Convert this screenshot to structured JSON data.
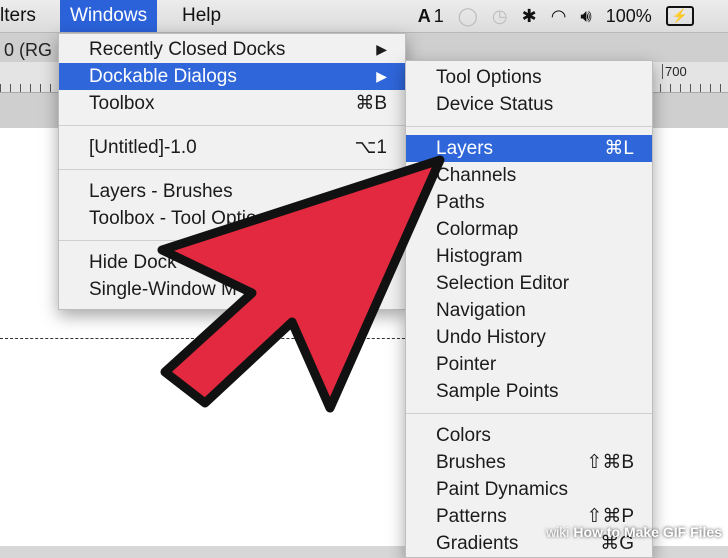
{
  "menubar": {
    "items": [
      "lters",
      "Windows",
      "Help"
    ],
    "status": {
      "adobe_count": "1",
      "battery": "100%"
    }
  },
  "window": {
    "title_fragment": "0 (RG",
    "ruler_mark": "700"
  },
  "windows_menu": {
    "items": [
      {
        "label": "Recently Closed Docks",
        "shortcut": "",
        "submenu": true
      },
      {
        "label": "Dockable Dialogs",
        "shortcut": "",
        "submenu": true,
        "highlighted": true
      },
      {
        "label": "Toolbox",
        "shortcut": "⌘B"
      },
      {
        "label": "[Untitled]-1.0",
        "shortcut": "⌥1"
      },
      {
        "label": "Layers - Brushes",
        "shortcut": ""
      },
      {
        "label": "Toolbox - Tool Optio",
        "shortcut": ""
      },
      {
        "label": "Hide Dock",
        "shortcut": ""
      },
      {
        "label": "Single-Window M",
        "shortcut": ""
      }
    ]
  },
  "dockable_menu": {
    "items": [
      {
        "label": "Tool Options",
        "shortcut": ""
      },
      {
        "label": "Device Status",
        "shortcut": ""
      },
      {
        "label": "Layers",
        "shortcut": "⌘L",
        "highlighted": true
      },
      {
        "label": "Channels",
        "shortcut": ""
      },
      {
        "label": "Paths",
        "shortcut": ""
      },
      {
        "label": "Colormap",
        "shortcut": ""
      },
      {
        "label": "Histogram",
        "shortcut": ""
      },
      {
        "label": "Selection Editor",
        "shortcut": ""
      },
      {
        "label": "Navigation",
        "shortcut": ""
      },
      {
        "label": "Undo History",
        "shortcut": ""
      },
      {
        "label": "Pointer",
        "shortcut": ""
      },
      {
        "label": "Sample Points",
        "shortcut": ""
      },
      {
        "label": "Colors",
        "shortcut": ""
      },
      {
        "label": "Brushes",
        "shortcut": "⇧⌘B"
      },
      {
        "label": "Paint Dynamics",
        "shortcut": ""
      },
      {
        "label": "Patterns",
        "shortcut": "⇧⌘P"
      },
      {
        "label": "Gradients",
        "shortcut": "⌘G"
      }
    ]
  },
  "watermark": {
    "prefix": "wiki",
    "text": "How to Make GIF Files"
  },
  "colors": {
    "highlight": "#2f66da",
    "arrow": "#e2293f"
  }
}
